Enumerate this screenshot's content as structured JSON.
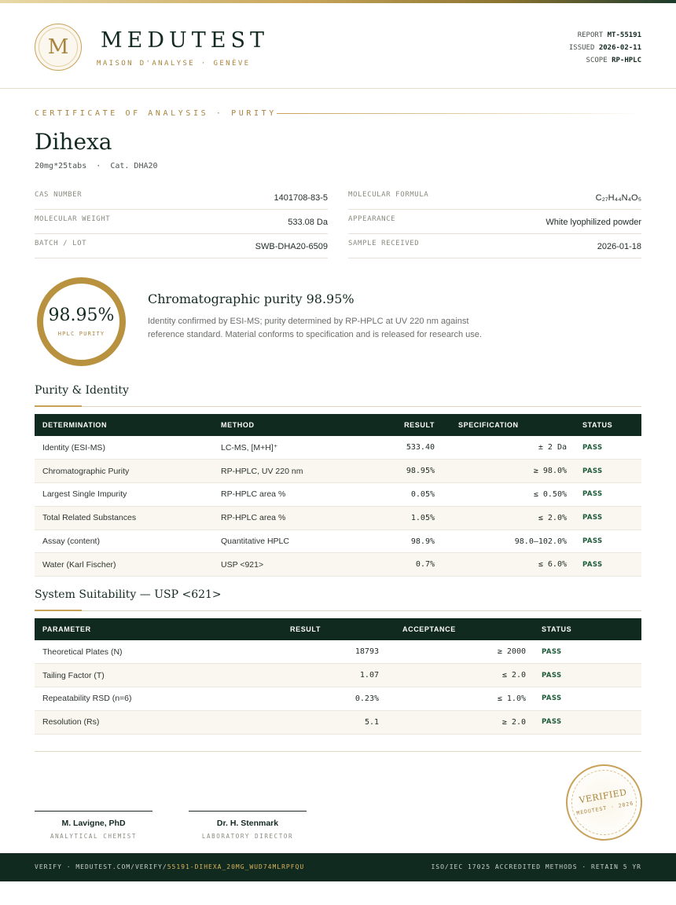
{
  "brand": {
    "logo_letter": "M",
    "name": "MEDUTEST",
    "tagline": "MAISON D'ANALYSE · GENÈVE"
  },
  "report": {
    "report_label": "REPORT",
    "report_id": "MT-55191",
    "issued_label": "ISSUED",
    "issued": "2026-02-11",
    "scope_label": "SCOPE",
    "scope": "RP-HPLC"
  },
  "certificate": {
    "eyebrow": "CERTIFICATE OF ANALYSIS · PURITY",
    "product": "Dihexa",
    "product_sub": "20mg*25tabs  ·  Cat. DHA20"
  },
  "info": {
    "left": [
      {
        "key": "CAS NUMBER",
        "value": "1401708-83-5"
      },
      {
        "key": "MOLECULAR WEIGHT",
        "value": "533.08 Da"
      },
      {
        "key": "BATCH / LOT",
        "value": "SWB-DHA20-6509"
      }
    ],
    "right": [
      {
        "key": "MOLECULAR FORMULA",
        "value": "C₂₇H₄₄N₄O₅"
      },
      {
        "key": "APPEARANCE",
        "value": "White lyophilized powder"
      },
      {
        "key": "SAMPLE RECEIVED",
        "value": "2026-01-18"
      }
    ]
  },
  "purity": {
    "value": "98.95%",
    "label": "HPLC PURITY",
    "title": "Chromatographic purity 98.95%",
    "text": "Identity confirmed by ESI-MS; purity determined by RP-HPLC at UV 220 nm against reference standard. Material conforms to specification and is released for research use."
  },
  "identity_section": {
    "title": "Purity & Identity",
    "headers": [
      "DETERMINATION",
      "METHOD",
      "RESULT",
      "SPECIFICATION",
      "STATUS"
    ],
    "rows": [
      {
        "determination": "Identity (ESI-MS)",
        "method": "LC-MS, [M+H]⁺",
        "result": "533.40",
        "spec": "± 2 Da",
        "status": "PASS"
      },
      {
        "determination": "Chromatographic Purity",
        "method": "RP-HPLC, UV 220 nm",
        "result": "98.95%",
        "spec": "≥ 98.0%",
        "status": "PASS"
      },
      {
        "determination": "Largest Single Impurity",
        "method": "RP-HPLC area %",
        "result": "0.05%",
        "spec": "≤ 0.50%",
        "status": "PASS"
      },
      {
        "determination": "Total Related Substances",
        "method": "RP-HPLC area %",
        "result": "1.05%",
        "spec": "≤ 2.0%",
        "status": "PASS"
      },
      {
        "determination": "Assay (content)",
        "method": "Quantitative HPLC",
        "result": "98.9%",
        "spec": "98.0–102.0%",
        "status": "PASS"
      },
      {
        "determination": "Water (Karl Fischer)",
        "method": "USP <921>",
        "result": "0.7%",
        "spec": "≤ 6.0%",
        "status": "PASS"
      }
    ]
  },
  "suitability_section": {
    "title": "System Suitability — USP <621>",
    "headers": [
      "PARAMETER",
      "RESULT",
      "ACCEPTANCE",
      "STATUS"
    ],
    "rows": [
      {
        "parameter": "Theoretical Plates (N)",
        "result": "18793",
        "acceptance": "≥ 2000",
        "status": "PASS"
      },
      {
        "parameter": "Tailing Factor (T)",
        "result": "1.07",
        "acceptance": "≤ 2.0",
        "status": "PASS"
      },
      {
        "parameter": "Repeatability RSD (n=6)",
        "result": "0.23%",
        "acceptance": "≤ 1.0%",
        "status": "PASS"
      },
      {
        "parameter": "Resolution (Rs)",
        "result": "5.1",
        "acceptance": "≥ 2.0",
        "status": "PASS"
      }
    ]
  },
  "signatures": [
    {
      "name": "M. Lavigne, PhD",
      "role": "ANALYTICAL CHEMIST"
    },
    {
      "name": "Dr. H. Stenmark",
      "role": "LABORATORY DIRECTOR"
    }
  ],
  "stamp": {
    "main": "VERIFIED",
    "sub": "MEDUTEST · 2026"
  },
  "footer": {
    "verify_prefix": "VERIFY · MEDUTEST.COM/VERIFY/",
    "verify_code": "55191-DIHEXA_20MG_WUD74MLRPFQU",
    "right": "ISO/IEC 17025 ACCREDITED METHODS · RETAIN 5 YR"
  },
  "colors": {
    "brand_green": "#112a1f",
    "gold": "#c8a25a",
    "pass_green": "#1c5a38"
  }
}
